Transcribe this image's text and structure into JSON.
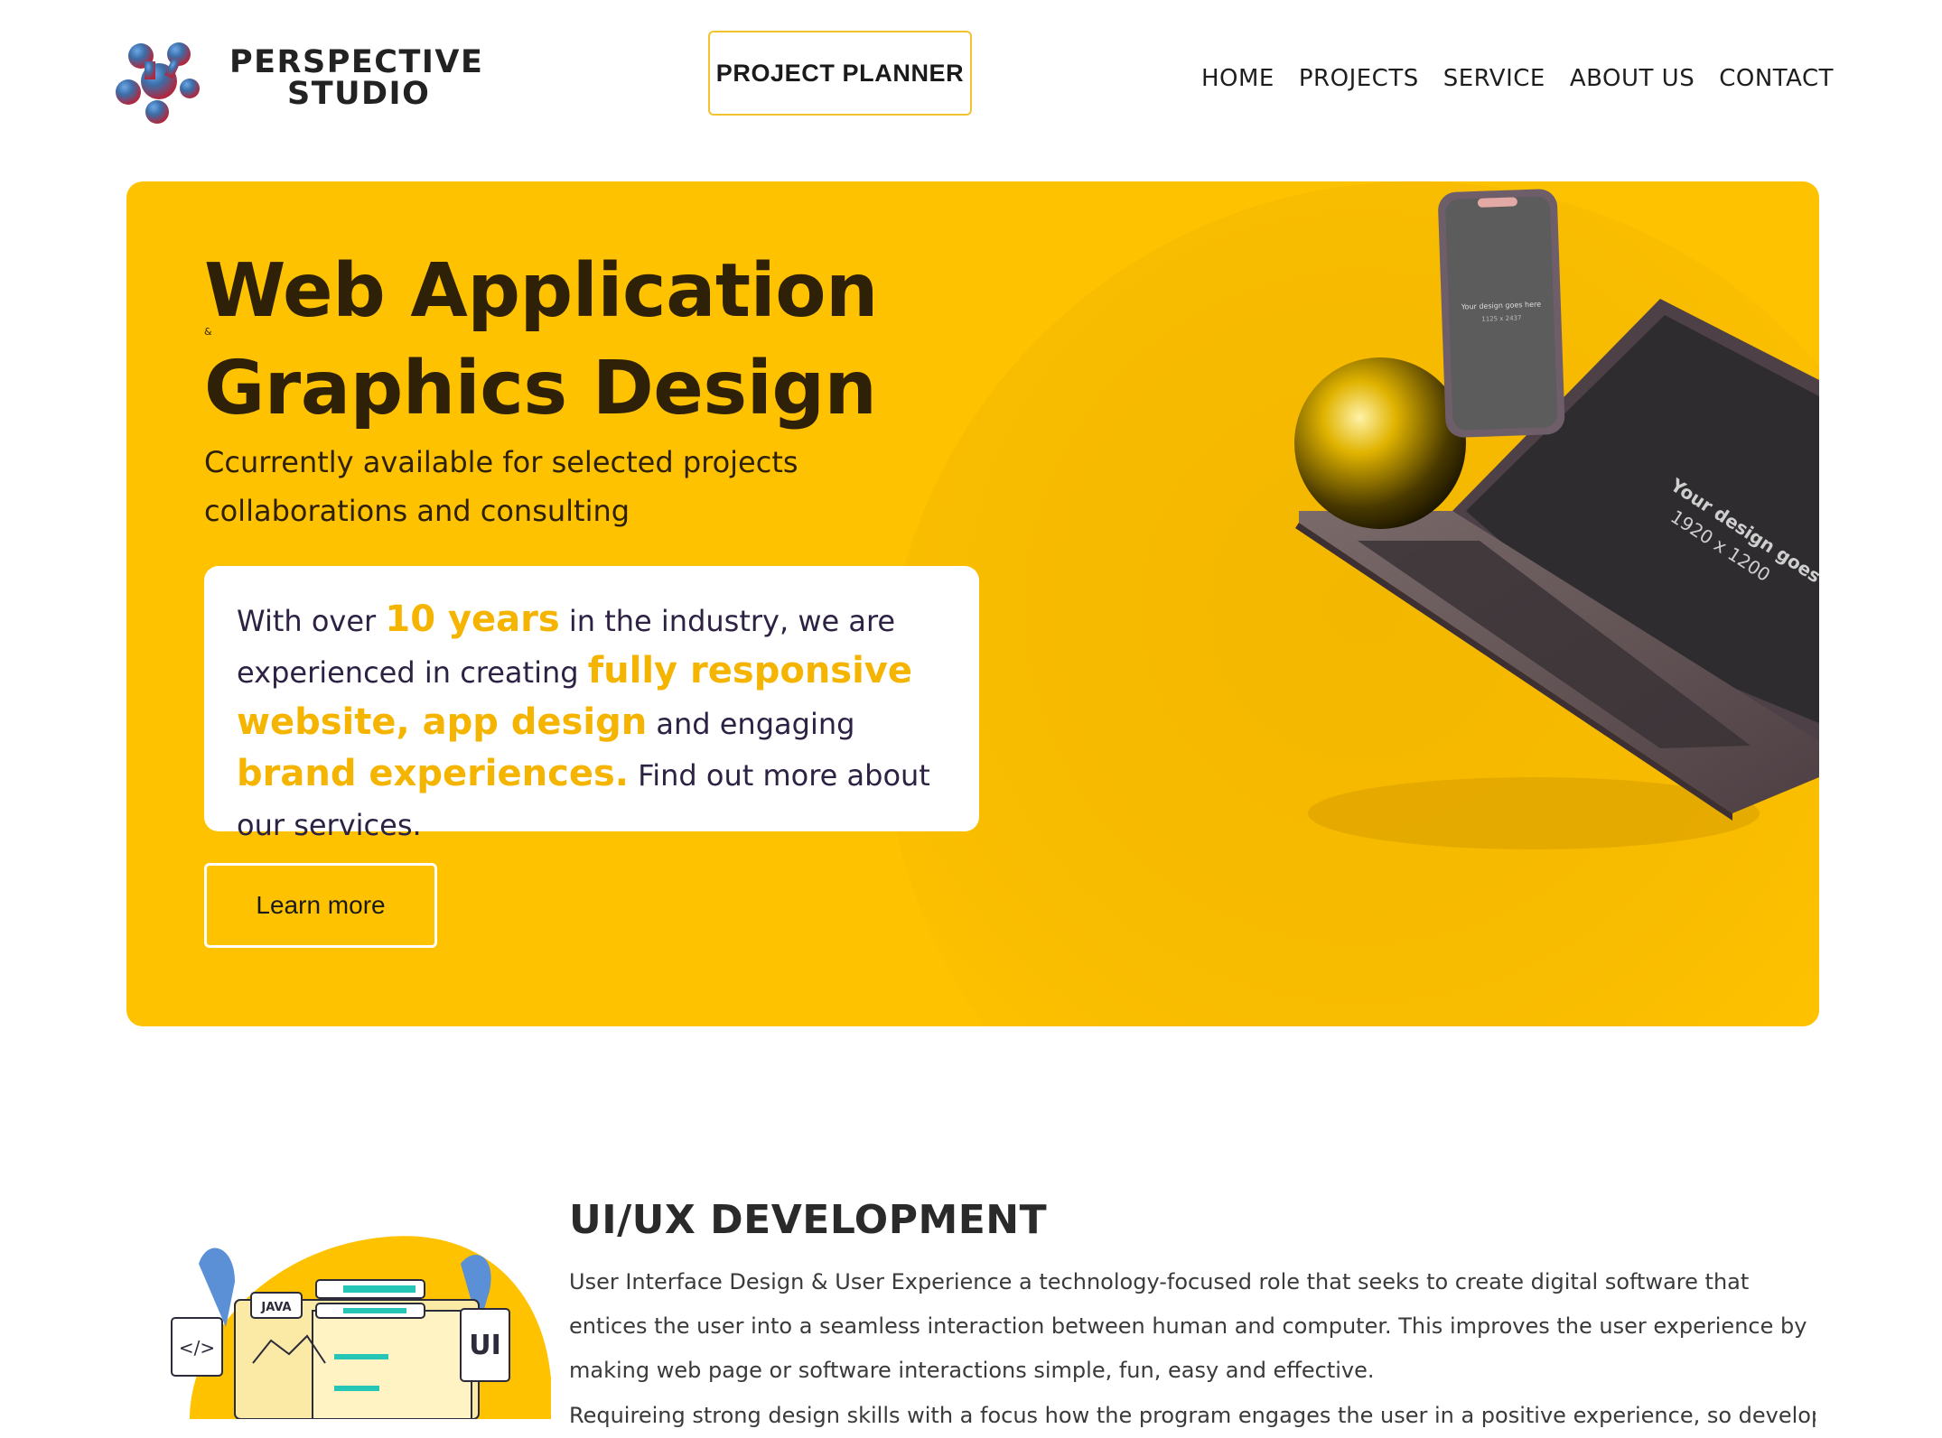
{
  "header": {
    "logo": {
      "line1": "PERSPECTIVE",
      "line2": "STUDIO"
    },
    "planner_label": "PROJECT PLANNER",
    "nav": [
      "HOME",
      "PROJECTS",
      "SERVICE",
      "ABOUT US",
      "CONTACT"
    ]
  },
  "hero": {
    "title_line1": "Web Application",
    "amp": "&",
    "title_line2": "Graphics Design",
    "subtitle": "Ccurrently available for selected projects collaborations and consulting",
    "card": {
      "t1": "With over ",
      "h1": "10 years",
      "t2": " in the industry, we are experienced in creating ",
      "h2": "fully responsive website, app design",
      "t3": " and engaging ",
      "h3": "brand experiences.",
      "t4": " Find out more about our services."
    },
    "cta_label": "Learn more",
    "phone_screen_text": "Your design goes here",
    "phone_screen_size": "1125 x 2437",
    "laptop_screen_text": "Your design goes here",
    "laptop_screen_size": "1920 x 1200"
  },
  "section": {
    "title": "UI/UX DEVELOPMENT",
    "paragraph1": "User Interface Design & User Experience a technology-focused role that seeks to create digital software that entices the user into a seamless interaction between human and computer. This improves the user experience by making web page or software interactions simple, fun, easy and effective.",
    "paragraph2": "Requireing strong design skills with a focus how the program engages the user in a positive experience, so developers our",
    "illustration": {
      "code_tag": "</>",
      "java_tag": "JAVA",
      "ui_tag": "UI"
    }
  },
  "colors": {
    "accent": "#ffc200",
    "highlight": "#f4b400",
    "dark_text": "#2e2108",
    "planner_border": "#f3c22f"
  }
}
